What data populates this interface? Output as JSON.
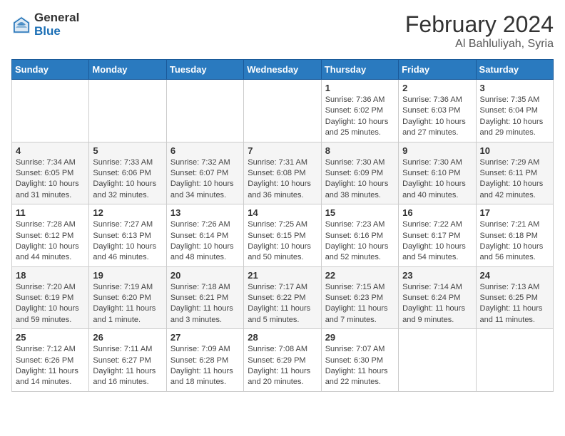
{
  "logo": {
    "general": "General",
    "blue": "Blue"
  },
  "header": {
    "title": "February 2024",
    "subtitle": "Al Bahluliyah, Syria"
  },
  "weekdays": [
    "Sunday",
    "Monday",
    "Tuesday",
    "Wednesday",
    "Thursday",
    "Friday",
    "Saturday"
  ],
  "weeks": [
    [
      {
        "day": "",
        "info": ""
      },
      {
        "day": "",
        "info": ""
      },
      {
        "day": "",
        "info": ""
      },
      {
        "day": "",
        "info": ""
      },
      {
        "day": "1",
        "info": "Sunrise: 7:36 AM\nSunset: 6:02 PM\nDaylight: 10 hours and 25 minutes."
      },
      {
        "day": "2",
        "info": "Sunrise: 7:36 AM\nSunset: 6:03 PM\nDaylight: 10 hours and 27 minutes."
      },
      {
        "day": "3",
        "info": "Sunrise: 7:35 AM\nSunset: 6:04 PM\nDaylight: 10 hours and 29 minutes."
      }
    ],
    [
      {
        "day": "4",
        "info": "Sunrise: 7:34 AM\nSunset: 6:05 PM\nDaylight: 10 hours and 31 minutes."
      },
      {
        "day": "5",
        "info": "Sunrise: 7:33 AM\nSunset: 6:06 PM\nDaylight: 10 hours and 32 minutes."
      },
      {
        "day": "6",
        "info": "Sunrise: 7:32 AM\nSunset: 6:07 PM\nDaylight: 10 hours and 34 minutes."
      },
      {
        "day": "7",
        "info": "Sunrise: 7:31 AM\nSunset: 6:08 PM\nDaylight: 10 hours and 36 minutes."
      },
      {
        "day": "8",
        "info": "Sunrise: 7:30 AM\nSunset: 6:09 PM\nDaylight: 10 hours and 38 minutes."
      },
      {
        "day": "9",
        "info": "Sunrise: 7:30 AM\nSunset: 6:10 PM\nDaylight: 10 hours and 40 minutes."
      },
      {
        "day": "10",
        "info": "Sunrise: 7:29 AM\nSunset: 6:11 PM\nDaylight: 10 hours and 42 minutes."
      }
    ],
    [
      {
        "day": "11",
        "info": "Sunrise: 7:28 AM\nSunset: 6:12 PM\nDaylight: 10 hours and 44 minutes."
      },
      {
        "day": "12",
        "info": "Sunrise: 7:27 AM\nSunset: 6:13 PM\nDaylight: 10 hours and 46 minutes."
      },
      {
        "day": "13",
        "info": "Sunrise: 7:26 AM\nSunset: 6:14 PM\nDaylight: 10 hours and 48 minutes."
      },
      {
        "day": "14",
        "info": "Sunrise: 7:25 AM\nSunset: 6:15 PM\nDaylight: 10 hours and 50 minutes."
      },
      {
        "day": "15",
        "info": "Sunrise: 7:23 AM\nSunset: 6:16 PM\nDaylight: 10 hours and 52 minutes."
      },
      {
        "day": "16",
        "info": "Sunrise: 7:22 AM\nSunset: 6:17 PM\nDaylight: 10 hours and 54 minutes."
      },
      {
        "day": "17",
        "info": "Sunrise: 7:21 AM\nSunset: 6:18 PM\nDaylight: 10 hours and 56 minutes."
      }
    ],
    [
      {
        "day": "18",
        "info": "Sunrise: 7:20 AM\nSunset: 6:19 PM\nDaylight: 10 hours and 59 minutes."
      },
      {
        "day": "19",
        "info": "Sunrise: 7:19 AM\nSunset: 6:20 PM\nDaylight: 11 hours and 1 minute."
      },
      {
        "day": "20",
        "info": "Sunrise: 7:18 AM\nSunset: 6:21 PM\nDaylight: 11 hours and 3 minutes."
      },
      {
        "day": "21",
        "info": "Sunrise: 7:17 AM\nSunset: 6:22 PM\nDaylight: 11 hours and 5 minutes."
      },
      {
        "day": "22",
        "info": "Sunrise: 7:15 AM\nSunset: 6:23 PM\nDaylight: 11 hours and 7 minutes."
      },
      {
        "day": "23",
        "info": "Sunrise: 7:14 AM\nSunset: 6:24 PM\nDaylight: 11 hours and 9 minutes."
      },
      {
        "day": "24",
        "info": "Sunrise: 7:13 AM\nSunset: 6:25 PM\nDaylight: 11 hours and 11 minutes."
      }
    ],
    [
      {
        "day": "25",
        "info": "Sunrise: 7:12 AM\nSunset: 6:26 PM\nDaylight: 11 hours and 14 minutes."
      },
      {
        "day": "26",
        "info": "Sunrise: 7:11 AM\nSunset: 6:27 PM\nDaylight: 11 hours and 16 minutes."
      },
      {
        "day": "27",
        "info": "Sunrise: 7:09 AM\nSunset: 6:28 PM\nDaylight: 11 hours and 18 minutes."
      },
      {
        "day": "28",
        "info": "Sunrise: 7:08 AM\nSunset: 6:29 PM\nDaylight: 11 hours and 20 minutes."
      },
      {
        "day": "29",
        "info": "Sunrise: 7:07 AM\nSunset: 6:30 PM\nDaylight: 11 hours and 22 minutes."
      },
      {
        "day": "",
        "info": ""
      },
      {
        "day": "",
        "info": ""
      }
    ]
  ]
}
